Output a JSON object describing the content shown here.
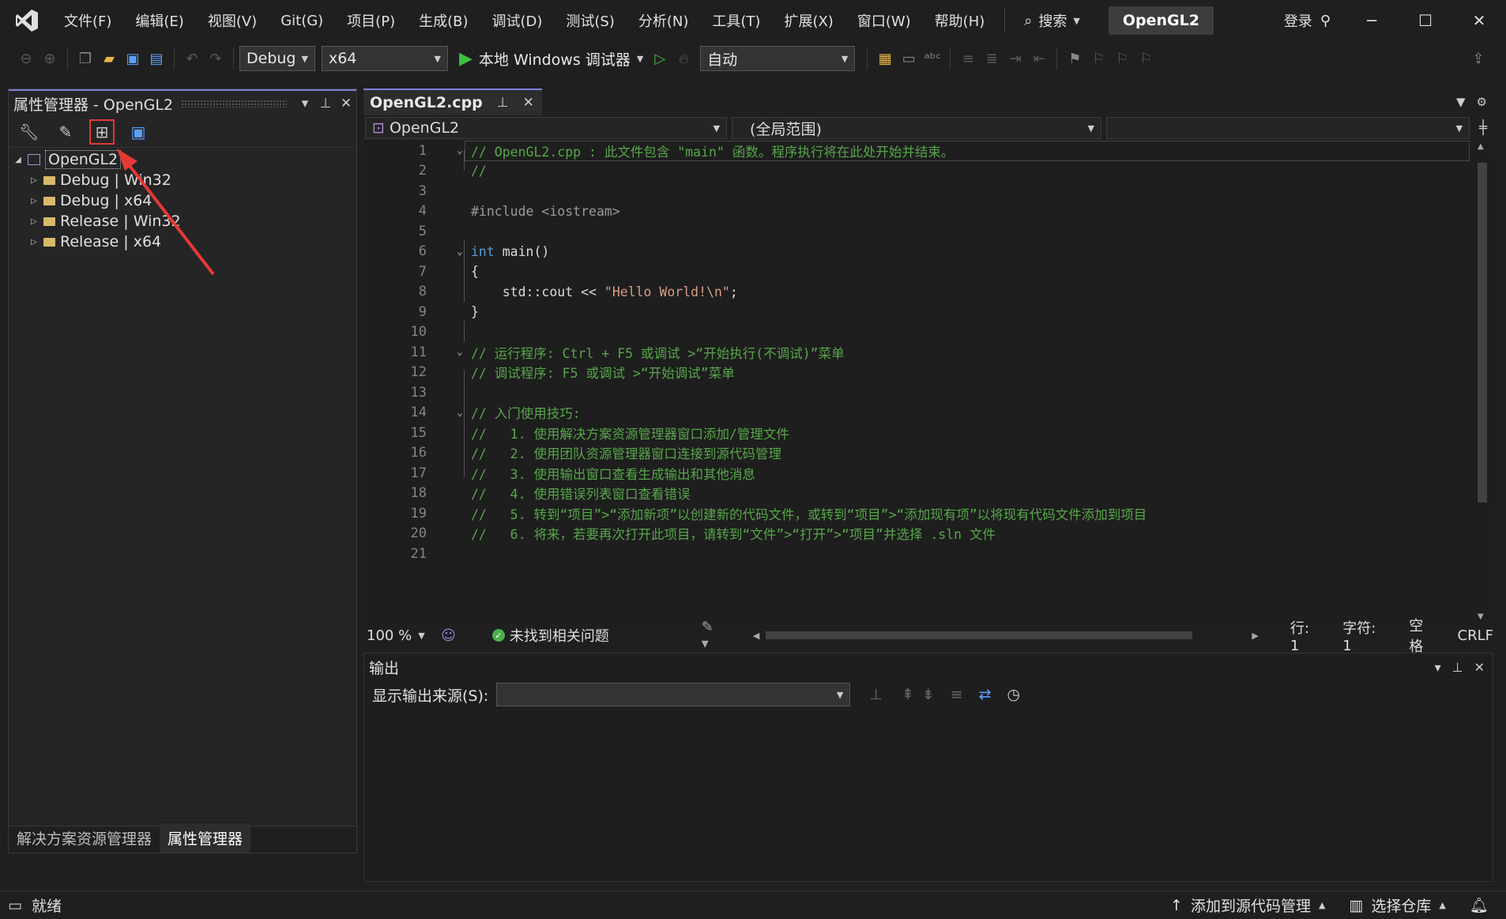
{
  "menubar": {
    "items": [
      "文件(F)",
      "编辑(E)",
      "视图(V)",
      "Git(G)",
      "项目(P)",
      "生成(B)",
      "调试(D)",
      "测试(S)",
      "分析(N)",
      "工具(T)",
      "扩展(X)",
      "窗口(W)",
      "帮助(H)"
    ],
    "search_label": "搜索",
    "solution_name": "OpenGL2",
    "login_label": "登录"
  },
  "toolbar": {
    "config": "Debug",
    "platform": "x64",
    "debugger_label": "本地 Windows 调试器",
    "auto_combo": "自动"
  },
  "property_manager": {
    "title": "属性管理器 - OpenGL2",
    "project": "OpenGL2",
    "configs": [
      "Debug | Win32",
      "Debug | x64",
      "Release | Win32",
      "Release | x64"
    ],
    "bottom_tabs": [
      "解决方案资源管理器",
      "属性管理器"
    ]
  },
  "editor": {
    "tab_name": "OpenGL2.cpp",
    "nav_project": "OpenGL2",
    "nav_scope": "(全局范围)",
    "lines": [
      {
        "n": "1",
        "text": "// OpenGL2.cpp : 此文件包含 \"main\" 函数。程序执行将在此处开始并结束。",
        "cls": "c-comment"
      },
      {
        "n": "2",
        "text": "//",
        "cls": "c-comment"
      },
      {
        "n": "3",
        "text": "",
        "cls": "c-plain"
      },
      {
        "n": "4",
        "text": "#include <iostream>",
        "cls": "c-pre"
      },
      {
        "n": "5",
        "text": "",
        "cls": "c-plain"
      },
      {
        "n": "6",
        "text": "int main()",
        "cls": "c-kw"
      },
      {
        "n": "7",
        "text": "{",
        "cls": "c-plain"
      },
      {
        "n": "8",
        "text": "    std::cout << \"Hello World!\\n\";",
        "cls": "c-plain"
      },
      {
        "n": "9",
        "text": "}",
        "cls": "c-plain"
      },
      {
        "n": "10",
        "text": "",
        "cls": "c-plain"
      },
      {
        "n": "11",
        "text": "// 运行程序: Ctrl + F5 或调试 >“开始执行(不调试)”菜单",
        "cls": "c-comment"
      },
      {
        "n": "12",
        "text": "// 调试程序: F5 或调试 >“开始调试”菜单",
        "cls": "c-comment"
      },
      {
        "n": "13",
        "text": "",
        "cls": "c-plain"
      },
      {
        "n": "14",
        "text": "// 入门使用技巧:",
        "cls": "c-comment"
      },
      {
        "n": "15",
        "text": "//   1. 使用解决方案资源管理器窗口添加/管理文件",
        "cls": "c-comment"
      },
      {
        "n": "16",
        "text": "//   2. 使用团队资源管理器窗口连接到源代码管理",
        "cls": "c-comment"
      },
      {
        "n": "17",
        "text": "//   3. 使用输出窗口查看生成输出和其他消息",
        "cls": "c-comment"
      },
      {
        "n": "18",
        "text": "//   4. 使用错误列表窗口查看错误",
        "cls": "c-comment"
      },
      {
        "n": "19",
        "text": "//   5. 转到“项目”>“添加新项”以创建新的代码文件，或转到“项目”>“添加现有项”以将现有代码文件添加到项目",
        "cls": "c-comment"
      },
      {
        "n": "20",
        "text": "//   6. 将来，若要再次打开此项目，请转到“文件”>“打开”>“项目”并选择 .sln 文件",
        "cls": "c-comment"
      },
      {
        "n": "21",
        "text": "",
        "cls": "c-plain"
      }
    ],
    "zoom": "100 %",
    "issues": "未找到相关问题",
    "row": "行: 1",
    "col": "字符: 1",
    "whitespace": "空格",
    "eol": "CRLF"
  },
  "output": {
    "title": "输出",
    "source_label": "显示输出来源(S):"
  },
  "statusbar": {
    "ready": "就绪",
    "source_control": "添加到源代码管理",
    "repo": "选择仓库"
  }
}
